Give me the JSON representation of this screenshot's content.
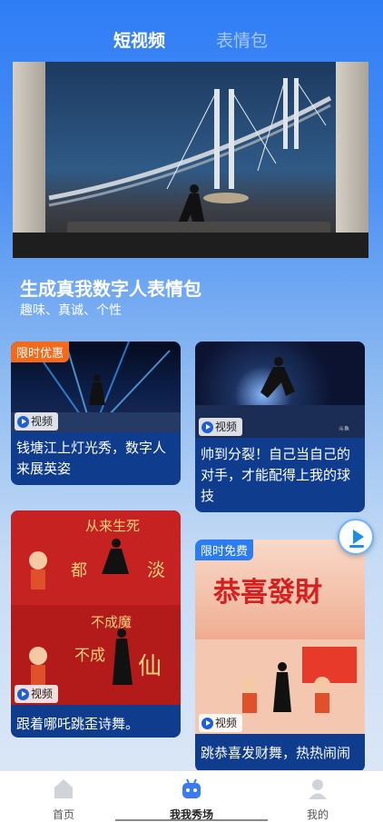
{
  "tabs": {
    "active": "短视频",
    "inactive": "表情包"
  },
  "hero": {
    "title": "生成真我数字人表情包",
    "subtitle": "趣味、真诚、个性"
  },
  "cards": [
    {
      "promo": "限时优惠",
      "video_label": "视频",
      "caption": "钱塘江上灯光秀，数字人来展英姿"
    },
    {
      "promo": "",
      "video_label": "视频",
      "caption": "帅到分裂！自己当自己的对手，才能配得上我的球技"
    },
    {
      "promo": "",
      "video_label": "视频",
      "caption": "跟着哪吒跳歪诗舞。"
    },
    {
      "promo": "限时免费",
      "video_label": "视频",
      "caption": "跳恭喜发财舞，热热闹闹"
    }
  ],
  "thumb_texts": {
    "fortune": "恭喜發財"
  },
  "bottom_nav": {
    "home": "首页",
    "show": "我我秀场",
    "mine": "我的"
  },
  "colors": {
    "brand_blue": "#2f7df6",
    "card_blue": "#0f3c8c",
    "promo_orange": "#f26b1d",
    "promo_blue": "#2a7cf0"
  }
}
